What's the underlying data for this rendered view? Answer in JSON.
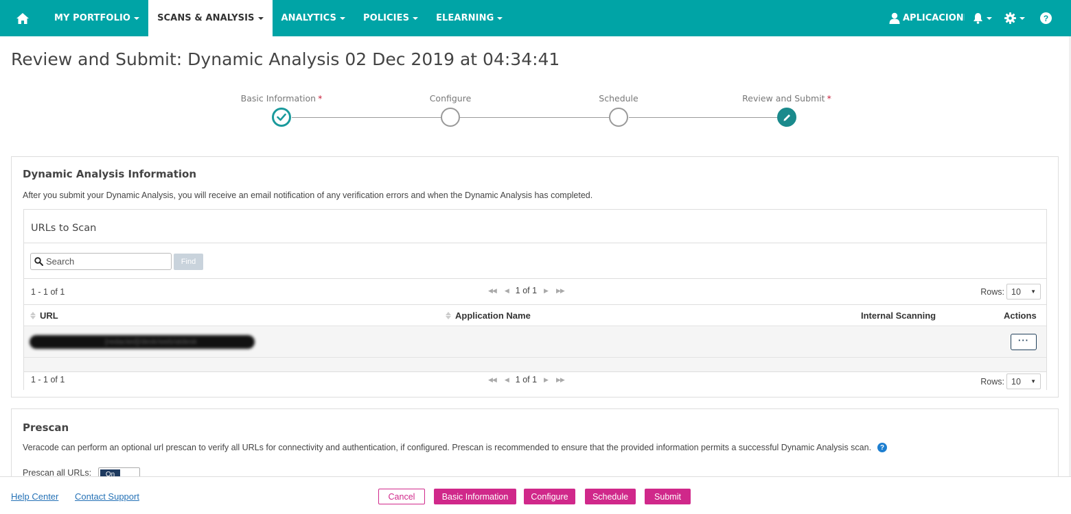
{
  "nav": {
    "items": [
      {
        "label": "MY PORTFOLIO",
        "active": false
      },
      {
        "label": "SCANS & ANALYSIS",
        "active": true
      },
      {
        "label": "ANALYTICS",
        "active": false
      },
      {
        "label": "POLICIES",
        "active": false
      },
      {
        "label": "ELEARNING",
        "active": false
      }
    ],
    "user_label": "APLICACIONES",
    "colors": {
      "bar": "#00a4a6",
      "active_bg": "#ffffff"
    }
  },
  "page": {
    "title": "Review and Submit: Dynamic Analysis 02 Dec 2019 at 04:34:41"
  },
  "wizard": {
    "steps": [
      {
        "label": "Basic Information",
        "required": "*",
        "state": "done"
      },
      {
        "label": "Configure",
        "required": "",
        "state": "todo"
      },
      {
        "label": "Schedule",
        "required": "",
        "state": "todo"
      },
      {
        "label": "Review and Submit",
        "required": "*",
        "state": "current"
      }
    ]
  },
  "dynamic_info": {
    "title": "Dynamic Analysis Information",
    "description": "After you submit your Dynamic Analysis, you will receive an email notification of any verification errors and when the Dynamic Analysis has completed."
  },
  "urls_table": {
    "title": "URLs to Scan",
    "search_placeholder": "Search",
    "find_label": "Find",
    "count_text": "1  - 1 of 1",
    "page_text": "1 of 1",
    "rows_label": "Rows:",
    "rows_value": "10",
    "columns": [
      "URL",
      "Application Name",
      "Internal Scanning",
      "Actions"
    ],
    "rows": [
      {
        "url": "[redacted]/desk/web/atdesk",
        "application_name": "",
        "internal_scanning": "",
        "actions": "···"
      }
    ]
  },
  "prescan": {
    "title": "Prescan",
    "description": "Veracode can perform an optional url prescan to verify all URLs for connectivity and authentication, if configured. Prescan is recommended to ensure that the provided information permits a successful Dynamic Analysis scan.",
    "toggle_label": "Prescan all URLs:",
    "toggle_value": "On"
  },
  "footer": {
    "help_center": "Help Center",
    "contact_support": "Contact Support",
    "cancel": "Cancel",
    "basic_information": "Basic Information",
    "configure": "Configure",
    "schedule": "Schedule",
    "submit": "Submit",
    "accent_color": "#d0288a"
  }
}
